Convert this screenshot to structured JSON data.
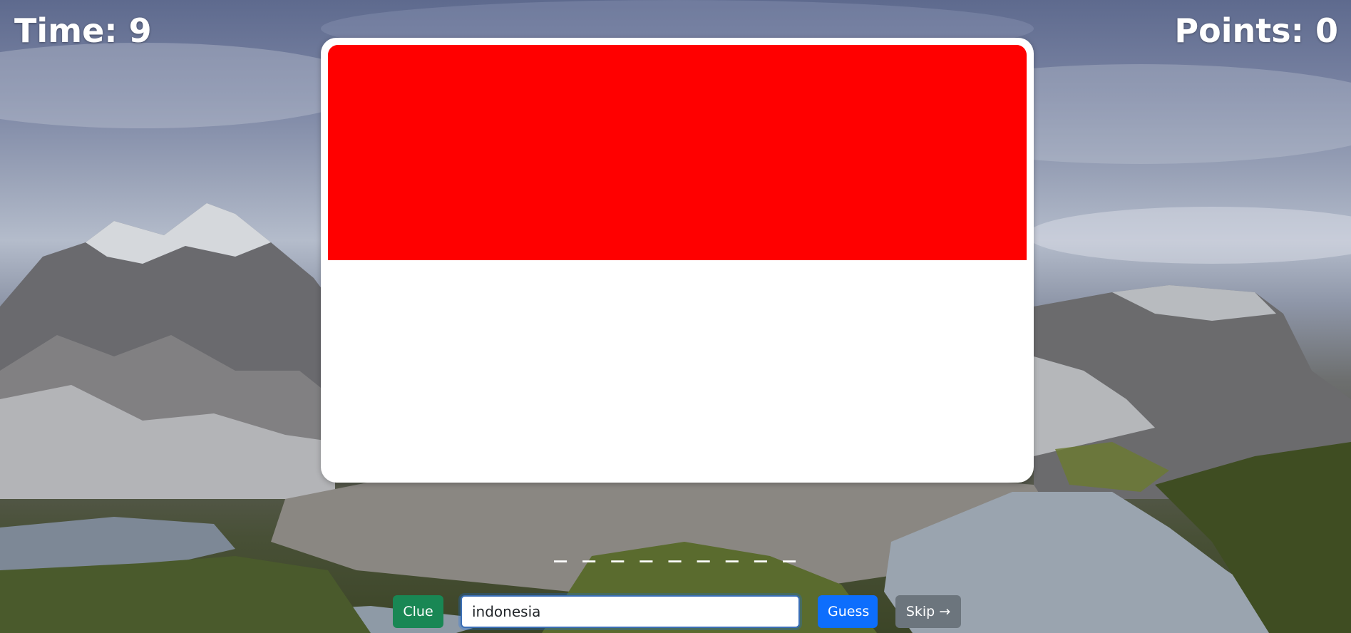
{
  "hud": {
    "time_label": "Time: 9",
    "points_label": "Points: 0"
  },
  "flag": {
    "colors": {
      "top": "#ff0000",
      "bottom": "#ffffff"
    }
  },
  "answer": {
    "blanks": "_ _ _ _ _ _ _ _ _"
  },
  "controls": {
    "clue_label": "Clue",
    "guess_value": "indonesia",
    "guess_label": "Guess",
    "skip_label": "Skip →"
  },
  "colors": {
    "clue_button": "#198754",
    "guess_button": "#0d6efd",
    "skip_button": "#6c757d"
  }
}
